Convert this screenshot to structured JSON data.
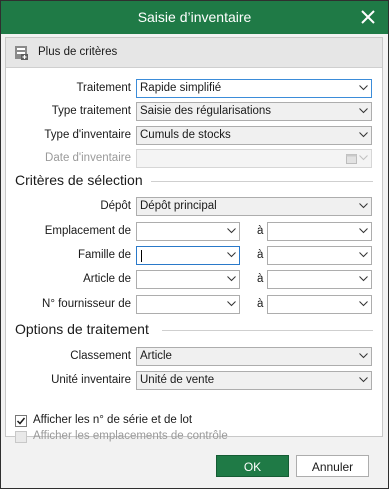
{
  "window": {
    "title": "Saisie d’inventaire"
  },
  "more_criteria": {
    "label": "Plus de critères"
  },
  "fields": {
    "traitement": {
      "label": "Traitement",
      "value": "Rapide simplifié"
    },
    "type_traitement": {
      "label": "Type traitement",
      "value": "Saisie des régularisations"
    },
    "type_inventaire": {
      "label": "Type d'inventaire",
      "value": "Cumuls de stocks"
    },
    "date_inventaire": {
      "label": "Date d'inventaire",
      "value": ""
    }
  },
  "selection": {
    "heading": "Critères de sélection",
    "depot": {
      "label": "Dépôt",
      "value": "Dépôt principal"
    },
    "range_to_label": "à",
    "rows": [
      {
        "label": "Emplacement de",
        "from": "",
        "to": ""
      },
      {
        "label": "Famille de",
        "from": "",
        "to": ""
      },
      {
        "label": "Article de",
        "from": "",
        "to": ""
      },
      {
        "label": "N° fournisseur de",
        "from": "",
        "to": ""
      }
    ]
  },
  "options": {
    "heading": "Options de traitement",
    "classement": {
      "label": "Classement",
      "value": "Article"
    },
    "unite": {
      "label": "Unité inventaire",
      "value": "Unité de vente"
    }
  },
  "checkboxes": {
    "serie_lot": {
      "label": "Afficher les n° de série et de lot",
      "checked": true
    },
    "emplacements": {
      "label": "Afficher les emplacements de contrôle",
      "checked": false,
      "disabled": true
    }
  },
  "buttons": {
    "ok": "OK",
    "cancel": "Annuler"
  },
  "colors": {
    "accent": "#1f7a46",
    "focus": "#2a79c9"
  }
}
